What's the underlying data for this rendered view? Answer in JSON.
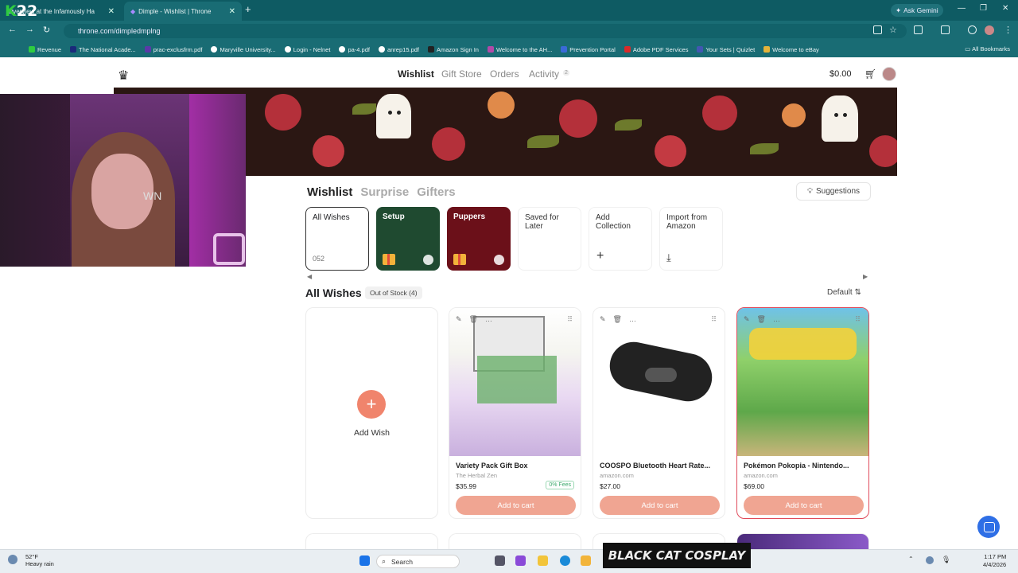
{
  "browser": {
    "tabs": [
      {
        "label": "Overview at the Infamously Ha"
      },
      {
        "label": "Dimple - Wishlist | Throne"
      }
    ],
    "url": "throne.com/dimpledmplng",
    "ask_gemini": "Ask Gemini",
    "bookmarks": [
      "Revenue",
      "The National Acade...",
      "prac-exclusfrm.pdf",
      "Maryville University...",
      "Login - Nelnet",
      "pa-4.pdf",
      "anrep15.pdf",
      "Amazon Sign In",
      "Welcome to the AH...",
      "Prevention Portal",
      "Adobe PDF Services",
      "Your Sets | Quizlet",
      "Welcome to eBay"
    ],
    "all_bookmarks": "All Bookmarks"
  },
  "overlay": {
    "k_score": "22",
    "cam_text": "WN",
    "stream_label": "BLACK CAT COSPLAY"
  },
  "site": {
    "nav": [
      "Wishlist",
      "Gift Store",
      "Orders",
      "Activity"
    ],
    "activity_badge": "2",
    "balance": "$0.00",
    "subtabs": [
      "Wishlist",
      "Surprise",
      "Gifters"
    ],
    "suggestions": "Suggestions",
    "collections": [
      {
        "label": "All Wishes",
        "count": "052"
      },
      {
        "label": "Setup",
        "color": "#1f4a30"
      },
      {
        "label": "Puppers",
        "color": "#6b1019"
      },
      {
        "label": "Saved for Later"
      },
      {
        "label": "Add Collection"
      },
      {
        "label": "Import from Amazon"
      }
    ],
    "section_title": "All Wishes",
    "out_of_stock": "Out of Stock (4)",
    "sort": "Default",
    "add_wish": "Add Wish",
    "items": [
      {
        "title": "Variety Pack Gift Box",
        "store": "The Herbal Zen",
        "price": "$35.99",
        "badge": "0% Fees",
        "cart": "Add to cart"
      },
      {
        "title": "COOSPO Bluetooth Heart Rate...",
        "store": "amazon.com",
        "price": "$27.00",
        "cart": "Add to cart"
      },
      {
        "title": "Pokémon Pokopia - Nintendo...",
        "store": "amazon.com",
        "price": "$69.00",
        "cart": "Add to cart"
      }
    ]
  },
  "taskbar": {
    "weather_temp": "52°F",
    "weather_desc": "Heavy rain",
    "search": "Search",
    "time": "1:17 PM",
    "date": "4/4/2026"
  },
  "colors": {
    "accent": "#f0a592",
    "chrome": "#196c74"
  }
}
